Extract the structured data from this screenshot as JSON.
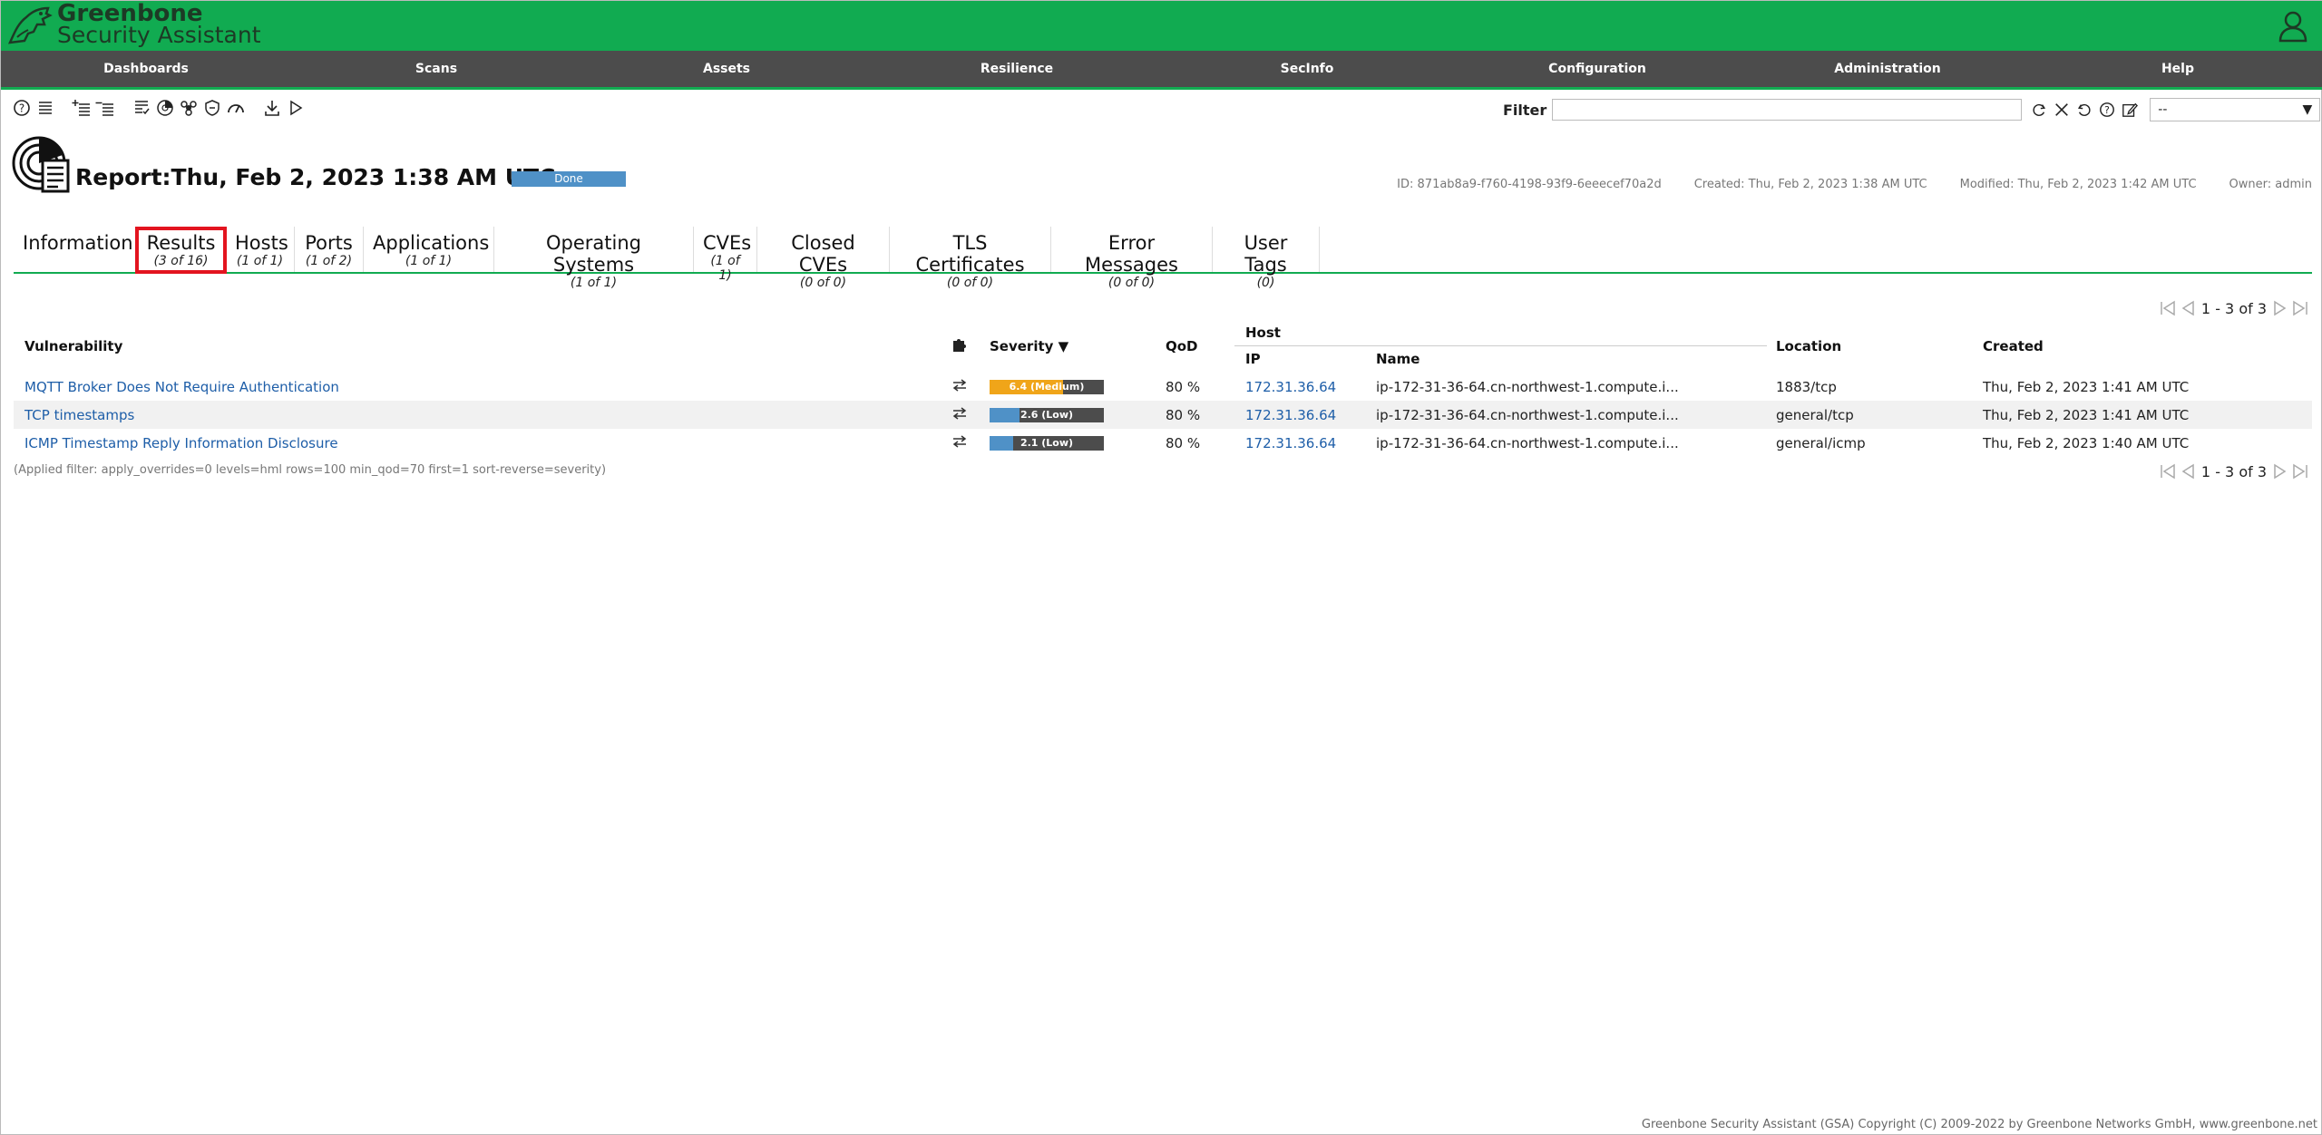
{
  "app": {
    "brand_line1": "Greenbone",
    "brand_line2": "Security Assistant"
  },
  "menu": {
    "items": [
      "Dashboards",
      "Scans",
      "Assets",
      "Resilience",
      "SecInfo",
      "Configuration",
      "Administration",
      "Help"
    ]
  },
  "filter": {
    "label": "Filter",
    "value": "",
    "selected": "--"
  },
  "report": {
    "title": "Report:Thu, Feb 2, 2023 1:38 AM UTC",
    "status": "Done",
    "id": "ID: 871ab8a9-f760-4198-93f9-6eeecef70a2d",
    "created": "Created: Thu, Feb 2, 2023 1:38 AM UTC",
    "modified": "Modified: Thu, Feb 2, 2023 1:42 AM UTC",
    "owner": "Owner: admin"
  },
  "tabs": [
    {
      "label": "Information",
      "count": ""
    },
    {
      "label": "Results",
      "count": "(3 of 16)"
    },
    {
      "label": "Hosts",
      "count": "(1 of 1)"
    },
    {
      "label": "Ports",
      "count": "(1 of 2)"
    },
    {
      "label": "Applications",
      "count": "(1 of 1)"
    },
    {
      "label": "Operating Systems",
      "count": "(1 of 1)"
    },
    {
      "label": "CVEs",
      "count": "(1 of 1)"
    },
    {
      "label": "Closed CVEs",
      "count": "(0 of 0)"
    },
    {
      "label": "TLS Certificates",
      "count": "(0 of 0)"
    },
    {
      "label": "Error Messages",
      "count": "(0 of 0)"
    },
    {
      "label": "User Tags",
      "count": "(0)"
    }
  ],
  "pagination": {
    "text": "1 - 3 of 3"
  },
  "table": {
    "headers": {
      "vulnerability": "Vulnerability",
      "severity": "Severity ▼",
      "qod": "QoD",
      "host": "Host",
      "ip": "IP",
      "name": "Name",
      "location": "Location",
      "created": "Created"
    },
    "rows": [
      {
        "vulnerability": "MQTT Broker Does Not Require Authentication",
        "severity": "6.4 (Medium)",
        "severity_value": 6.4,
        "severity_color": "#f0a519",
        "qod": "80 %",
        "ip": "172.31.36.64",
        "name": "ip-172-31-36-64.cn-northwest-1.compute.i...",
        "location": "1883/tcp",
        "created": "Thu, Feb 2, 2023 1:41 AM UTC"
      },
      {
        "vulnerability": "TCP timestamps",
        "severity": "2.6 (Low)",
        "severity_value": 2.6,
        "severity_color": "#4f91c7",
        "qod": "80 %",
        "ip": "172.31.36.64",
        "name": "ip-172-31-36-64.cn-northwest-1.compute.i...",
        "location": "general/tcp",
        "created": "Thu, Feb 2, 2023 1:41 AM UTC"
      },
      {
        "vulnerability": "ICMP Timestamp Reply Information Disclosure",
        "severity": "2.1 (Low)",
        "severity_value": 2.1,
        "severity_color": "#4f91c7",
        "qod": "80 %",
        "ip": "172.31.36.64",
        "name": "ip-172-31-36-64.cn-northwest-1.compute.i...",
        "location": "general/icmp",
        "created": "Thu, Feb 2, 2023 1:40 AM UTC"
      }
    ]
  },
  "applied_filter": "(Applied filter: apply_overrides=0 levels=hml rows=100 min_qod=70 first=1 sort-reverse=severity)",
  "footer": "Greenbone Security Assistant (GSA) Copyright (C) 2009-2022 by Greenbone Networks GmbH, www.greenbone.net",
  "colors": {
    "brand_green": "#11ab51",
    "menu_bg": "#4c4c4c",
    "link": "#1e5ea8",
    "highlight": "#e3141f"
  }
}
